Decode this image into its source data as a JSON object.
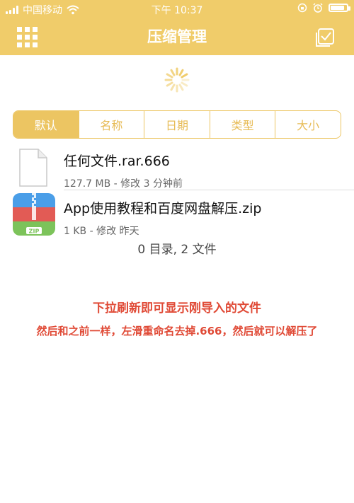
{
  "status_bar": {
    "carrier": "中国移动",
    "time": "下午 10:37",
    "battery_level": 0.85
  },
  "nav": {
    "title": "压缩管理",
    "left_icon": "grid-icon",
    "right_icon": "select-check-icon"
  },
  "loading": {
    "icon": "spinner-icon"
  },
  "sort_tabs": [
    {
      "label": "默认",
      "active": true
    },
    {
      "label": "名称",
      "active": false
    },
    {
      "label": "日期",
      "active": false
    },
    {
      "label": "类型",
      "active": false
    },
    {
      "label": "大小",
      "active": false
    }
  ],
  "files": [
    {
      "name": "任何文件.rar.666",
      "meta": "127.7 MB - 修改 3 分钟前",
      "icon": "blank-document-icon"
    },
    {
      "name": "App使用教程和百度网盘解压.zip",
      "meta": "1 KB - 修改 昨天",
      "icon": "zip-archive-icon",
      "icon_badge": "ZIP"
    }
  ],
  "summary": "0 目录, 2 文件",
  "hints": {
    "line1": "下拉刷新即可显示刚导入的文件",
    "line2": "然后和之前一样，左滑重命名去掉.666，然后就可以解压了"
  },
  "colors": {
    "header": "#f0cc6a",
    "accent": "#ecc562",
    "hint": "#e04a36"
  }
}
